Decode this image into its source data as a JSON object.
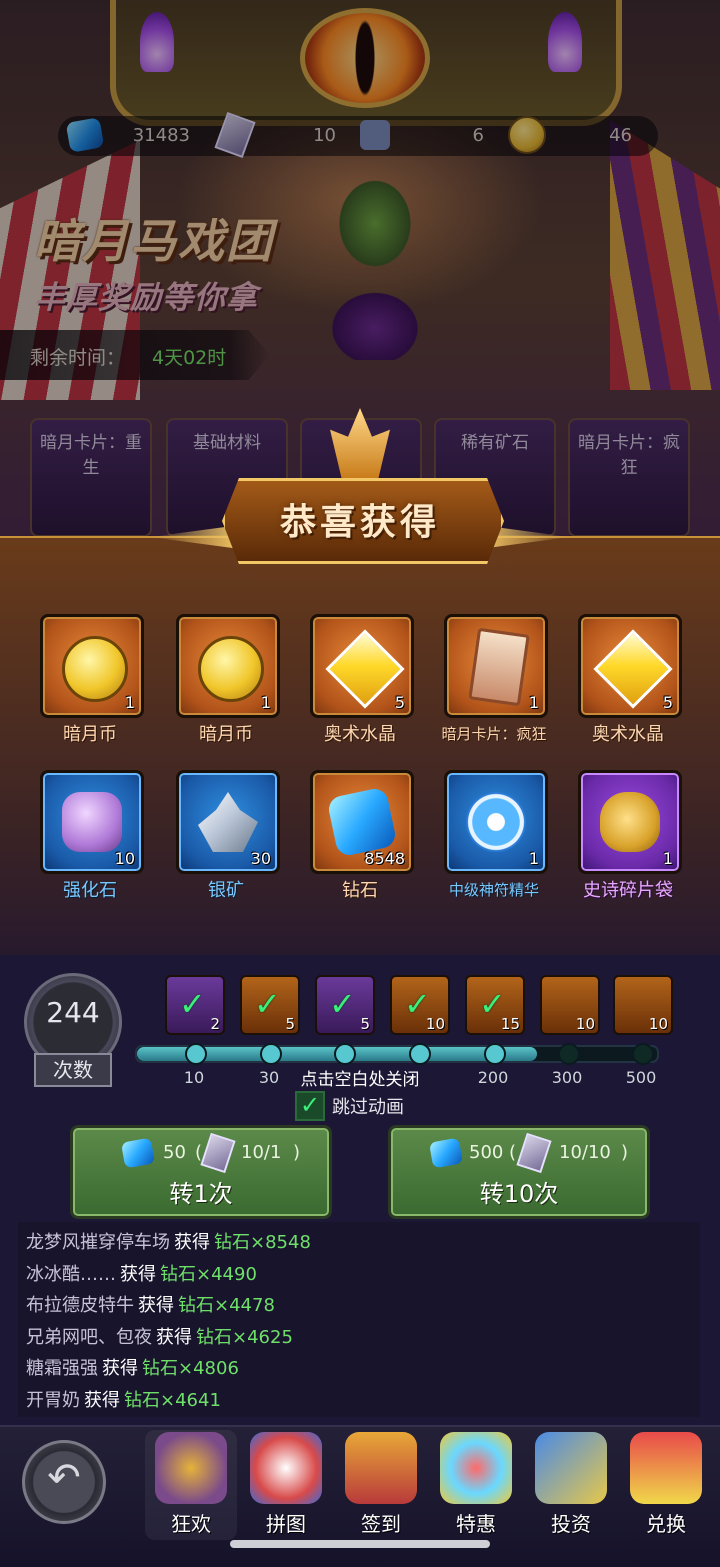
{
  "currency": {
    "diamonds": "31483",
    "tickets": "10",
    "puzzles": "6",
    "coins": "46"
  },
  "event": {
    "title": "暗月马戏团",
    "subtitle": "丰厚奖励等你拿",
    "timer_label": "剩余时间：",
    "timer_value": "4天02时"
  },
  "bg_tabs": [
    "暗月卡片：重生",
    "基础材料",
    "",
    "稀有矿石",
    "暗月卡片：疯狂"
  ],
  "popup": {
    "title": "恭喜获得",
    "rewards": [
      {
        "name": "暗月币",
        "qty": "1",
        "rarity": "orange",
        "icon": "coin-icon"
      },
      {
        "name": "暗月币",
        "qty": "1",
        "rarity": "orange",
        "icon": "coin-icon"
      },
      {
        "name": "奥术水晶",
        "qty": "5",
        "rarity": "orange",
        "icon": "crystal-icon"
      },
      {
        "name": "暗月卡片：疯狂",
        "qty": "1",
        "rarity": "orange",
        "icon": "card-icon"
      },
      {
        "name": "奥术水晶",
        "qty": "5",
        "rarity": "orange",
        "icon": "crystal-icon"
      },
      {
        "name": "强化石",
        "qty": "10",
        "rarity": "blue",
        "icon": "stone-icon"
      },
      {
        "name": "银矿",
        "qty": "30",
        "rarity": "blue",
        "icon": "silver-ore-icon"
      },
      {
        "name": "钻石",
        "qty": "8548",
        "rarity": "orange",
        "icon": "diamond-icon"
      },
      {
        "name": "中级神符精华",
        "qty": "1",
        "rarity": "blue",
        "icon": "rune-icon"
      },
      {
        "name": "史诗碎片袋",
        "qty": "1",
        "rarity": "purple",
        "icon": "bag-icon"
      }
    ],
    "close_hint": "点击空白处关闭"
  },
  "spin_count": {
    "value": "244",
    "label": "次数"
  },
  "milestone_rewards": [
    {
      "qty": "2",
      "claimed": true,
      "color": "purple"
    },
    {
      "qty": "5",
      "claimed": true,
      "color": "orange"
    },
    {
      "qty": "5",
      "claimed": true,
      "color": "purple"
    },
    {
      "qty": "10",
      "claimed": true,
      "color": "orange"
    },
    {
      "qty": "15",
      "claimed": true,
      "color": "orange"
    },
    {
      "qty": "10",
      "claimed": false,
      "color": "orange"
    },
    {
      "qty": "10",
      "claimed": false,
      "color": "orange"
    }
  ],
  "milestones": [
    "10",
    "30",
    "",
    "",
    "200",
    "300",
    "500"
  ],
  "progress_reached": 5,
  "skip_animation": {
    "label": "跳过动画",
    "checked": true
  },
  "spin_buttons": [
    {
      "diamond_cost": "50",
      "ticket_cost": "10/1",
      "label": "转1次"
    },
    {
      "diamond_cost": "500",
      "ticket_cost": "10/10",
      "label": "转10次"
    }
  ],
  "log": [
    {
      "user": "龙梦风摧穿停车场",
      "action": "获得",
      "item": "钻石×8548"
    },
    {
      "user": "冰冰酷……",
      "action": "获得",
      "item": "钻石×4490"
    },
    {
      "user": "布拉德皮特牛",
      "action": "获得",
      "item": "钻石×4478"
    },
    {
      "user": "兄弟网吧、包夜",
      "action": "获得",
      "item": "钻石×4625"
    },
    {
      "user": "糖霜强强",
      "action": "获得",
      "item": "钻石×4806"
    },
    {
      "user": "开胃奶",
      "action": "获得",
      "item": "钻石×4641"
    }
  ],
  "nav": [
    {
      "label": "狂欢",
      "icon": "ferris-wheel-icon",
      "active": true
    },
    {
      "label": "拼图",
      "icon": "clown-face-icon",
      "active": false
    },
    {
      "label": "签到",
      "icon": "jack-in-box-icon",
      "active": false
    },
    {
      "label": "特惠",
      "icon": "balloon-gift-icon",
      "active": false
    },
    {
      "label": "投资",
      "icon": "jester-cards-icon",
      "active": false
    },
    {
      "label": "兑换",
      "icon": "clown-tent-icon",
      "active": false
    }
  ],
  "colors": {
    "timer_green": "#76e062",
    "log_item_green": "#6ee06a",
    "popup_gold": "#f2c766"
  }
}
